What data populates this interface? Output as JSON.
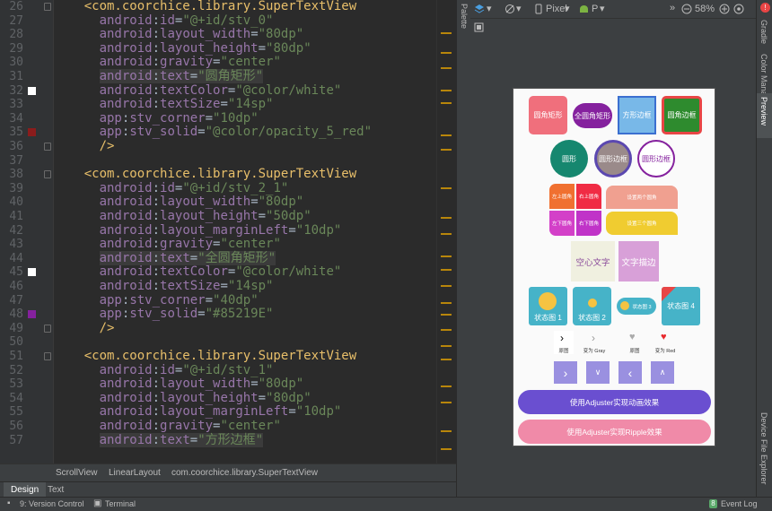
{
  "editor": {
    "lines": [
      {
        "n": "26",
        "parts": [
          [
            "sp",
            "    "
          ],
          [
            "tag",
            "<com.coorchice.library.SuperTextView"
          ]
        ]
      },
      {
        "n": "27",
        "parts": [
          [
            "sp",
            "      "
          ],
          [
            "attr",
            "android"
          ],
          [
            "eq",
            ":"
          ],
          [
            "attr",
            "id"
          ],
          [
            "eq",
            "="
          ],
          [
            "str",
            "\"@+id/stv_0\""
          ]
        ]
      },
      {
        "n": "28",
        "parts": [
          [
            "sp",
            "      "
          ],
          [
            "attr",
            "android"
          ],
          [
            "eq",
            ":"
          ],
          [
            "attr",
            "layout_width"
          ],
          [
            "eq",
            "="
          ],
          [
            "str",
            "\"80dp\""
          ]
        ]
      },
      {
        "n": "29",
        "parts": [
          [
            "sp",
            "      "
          ],
          [
            "attr",
            "android"
          ],
          [
            "eq",
            ":"
          ],
          [
            "attr",
            "layout_height"
          ],
          [
            "eq",
            "="
          ],
          [
            "str",
            "\"80dp\""
          ]
        ]
      },
      {
        "n": "30",
        "parts": [
          [
            "sp",
            "      "
          ],
          [
            "attr",
            "android"
          ],
          [
            "eq",
            ":"
          ],
          [
            "attr",
            "gravity"
          ],
          [
            "eq",
            "="
          ],
          [
            "str",
            "\"center\""
          ]
        ]
      },
      {
        "n": "31",
        "parts": [
          [
            "sp",
            "      "
          ],
          [
            "hattr",
            "android"
          ],
          [
            "heq",
            ":"
          ],
          [
            "hattr",
            "text"
          ],
          [
            "heq",
            "="
          ],
          [
            "hstr",
            "\"圆角矩形\""
          ]
        ]
      },
      {
        "n": "32",
        "parts": [
          [
            "sp",
            "      "
          ],
          [
            "attr",
            "android"
          ],
          [
            "eq",
            ":"
          ],
          [
            "attr",
            "textColor"
          ],
          [
            "eq",
            "="
          ],
          [
            "str",
            "\"@color/white\""
          ]
        ]
      },
      {
        "n": "33",
        "parts": [
          [
            "sp",
            "      "
          ],
          [
            "attr",
            "android"
          ],
          [
            "eq",
            ":"
          ],
          [
            "attr",
            "textSize"
          ],
          [
            "eq",
            "="
          ],
          [
            "str",
            "\"14sp\""
          ]
        ]
      },
      {
        "n": "34",
        "parts": [
          [
            "sp",
            "      "
          ],
          [
            "attr",
            "app"
          ],
          [
            "eq",
            ":"
          ],
          [
            "attr",
            "stv_corner"
          ],
          [
            "eq",
            "="
          ],
          [
            "str",
            "\"10dp\""
          ]
        ]
      },
      {
        "n": "35",
        "parts": [
          [
            "sp",
            "      "
          ],
          [
            "attr",
            "app"
          ],
          [
            "eq",
            ":"
          ],
          [
            "attr",
            "stv_solid"
          ],
          [
            "eq",
            "="
          ],
          [
            "str",
            "\"@color/opacity_5_red\""
          ]
        ]
      },
      {
        "n": "36",
        "parts": [
          [
            "sp",
            "      "
          ],
          [
            "tag",
            "/>"
          ]
        ]
      },
      {
        "n": "37",
        "parts": []
      },
      {
        "n": "38",
        "parts": [
          [
            "sp",
            "    "
          ],
          [
            "tag",
            "<com.coorchice.library.SuperTextView"
          ]
        ]
      },
      {
        "n": "39",
        "parts": [
          [
            "sp",
            "      "
          ],
          [
            "attr",
            "android"
          ],
          [
            "eq",
            ":"
          ],
          [
            "attr",
            "id"
          ],
          [
            "eq",
            "="
          ],
          [
            "str",
            "\"@+id/stv_2_1\""
          ]
        ]
      },
      {
        "n": "40",
        "parts": [
          [
            "sp",
            "      "
          ],
          [
            "attr",
            "android"
          ],
          [
            "eq",
            ":"
          ],
          [
            "attr",
            "layout_width"
          ],
          [
            "eq",
            "="
          ],
          [
            "str",
            "\"80dp\""
          ]
        ]
      },
      {
        "n": "41",
        "parts": [
          [
            "sp",
            "      "
          ],
          [
            "attr",
            "android"
          ],
          [
            "eq",
            ":"
          ],
          [
            "attr",
            "layout_height"
          ],
          [
            "eq",
            "="
          ],
          [
            "str",
            "\"50dp\""
          ]
        ]
      },
      {
        "n": "42",
        "parts": [
          [
            "sp",
            "      "
          ],
          [
            "attr",
            "android"
          ],
          [
            "eq",
            ":"
          ],
          [
            "attr",
            "layout_marginLeft"
          ],
          [
            "eq",
            "="
          ],
          [
            "str",
            "\"10dp\""
          ]
        ]
      },
      {
        "n": "43",
        "parts": [
          [
            "sp",
            "      "
          ],
          [
            "attr",
            "android"
          ],
          [
            "eq",
            ":"
          ],
          [
            "attr",
            "gravity"
          ],
          [
            "eq",
            "="
          ],
          [
            "str",
            "\"center\""
          ]
        ]
      },
      {
        "n": "44",
        "parts": [
          [
            "sp",
            "      "
          ],
          [
            "hattr",
            "android"
          ],
          [
            "heq",
            ":"
          ],
          [
            "hattr",
            "text"
          ],
          [
            "heq",
            "="
          ],
          [
            "hstr",
            "\"全圆角矩形\""
          ]
        ]
      },
      {
        "n": "45",
        "parts": [
          [
            "sp",
            "      "
          ],
          [
            "attr",
            "android"
          ],
          [
            "eq",
            ":"
          ],
          [
            "attr",
            "textColor"
          ],
          [
            "eq",
            "="
          ],
          [
            "str",
            "\"@color/white\""
          ]
        ]
      },
      {
        "n": "46",
        "parts": [
          [
            "sp",
            "      "
          ],
          [
            "attr",
            "android"
          ],
          [
            "eq",
            ":"
          ],
          [
            "attr",
            "textSize"
          ],
          [
            "eq",
            "="
          ],
          [
            "str",
            "\"14sp\""
          ]
        ]
      },
      {
        "n": "47",
        "parts": [
          [
            "sp",
            "      "
          ],
          [
            "attr",
            "app"
          ],
          [
            "eq",
            ":"
          ],
          [
            "attr",
            "stv_corner"
          ],
          [
            "eq",
            "="
          ],
          [
            "str",
            "\"40dp\""
          ]
        ]
      },
      {
        "n": "48",
        "parts": [
          [
            "sp",
            "      "
          ],
          [
            "attr",
            "app"
          ],
          [
            "eq",
            ":"
          ],
          [
            "attr",
            "stv_solid"
          ],
          [
            "eq",
            "="
          ],
          [
            "str",
            "\"#85219E\""
          ]
        ]
      },
      {
        "n": "49",
        "parts": [
          [
            "sp",
            "      "
          ],
          [
            "tag",
            "/>"
          ]
        ]
      },
      {
        "n": "50",
        "parts": []
      },
      {
        "n": "51",
        "parts": [
          [
            "sp",
            "    "
          ],
          [
            "tag",
            "<com.coorchice.library.SuperTextView"
          ]
        ]
      },
      {
        "n": "52",
        "parts": [
          [
            "sp",
            "      "
          ],
          [
            "attr",
            "android"
          ],
          [
            "eq",
            ":"
          ],
          [
            "attr",
            "id"
          ],
          [
            "eq",
            "="
          ],
          [
            "str",
            "\"@+id/stv_1\""
          ]
        ]
      },
      {
        "n": "53",
        "parts": [
          [
            "sp",
            "      "
          ],
          [
            "attr",
            "android"
          ],
          [
            "eq",
            ":"
          ],
          [
            "attr",
            "layout_width"
          ],
          [
            "eq",
            "="
          ],
          [
            "str",
            "\"80dp\""
          ]
        ]
      },
      {
        "n": "54",
        "parts": [
          [
            "sp",
            "      "
          ],
          [
            "attr",
            "android"
          ],
          [
            "eq",
            ":"
          ],
          [
            "attr",
            "layout_height"
          ],
          [
            "eq",
            "="
          ],
          [
            "str",
            "\"80dp\""
          ]
        ]
      },
      {
        "n": "55",
        "parts": [
          [
            "sp",
            "      "
          ],
          [
            "attr",
            "android"
          ],
          [
            "eq",
            ":"
          ],
          [
            "attr",
            "layout_marginLeft"
          ],
          [
            "eq",
            "="
          ],
          [
            "str",
            "\"10dp\""
          ]
        ]
      },
      {
        "n": "56",
        "parts": [
          [
            "sp",
            "      "
          ],
          [
            "attr",
            "android"
          ],
          [
            "eq",
            ":"
          ],
          [
            "attr",
            "gravity"
          ],
          [
            "eq",
            "="
          ],
          [
            "str",
            "\"center\""
          ]
        ]
      },
      {
        "n": "57",
        "parts": [
          [
            "sp",
            "      "
          ],
          [
            "hattr",
            "android"
          ],
          [
            "heq",
            ":"
          ],
          [
            "hattr",
            "text"
          ],
          [
            "heq",
            "="
          ],
          [
            "hstr",
            "\"方形边框\""
          ]
        ]
      }
    ],
    "gutter_swatches": [
      {
        "line": "32",
        "color": "#ffffff"
      },
      {
        "line": "35",
        "color": "#8b1c1c"
      },
      {
        "line": "45",
        "color": "#ffffff"
      },
      {
        "line": "48",
        "color": "#85219e"
      }
    ]
  },
  "breadcrumb": {
    "items": [
      "ScrollView",
      "LinearLayout",
      "com.coorchice.library.SuperTextView"
    ]
  },
  "editor_tabs": {
    "design": "Design",
    "text": "Text"
  },
  "side_panels": {
    "palette": "Palette",
    "gradle": "Gradle",
    "color_manager": "Color Manager",
    "preview": "Preview",
    "device_file_explorer": "Device File Explorer"
  },
  "preview_toolbar": {
    "device": "Pixel",
    "api": "P",
    "zoom": "58%"
  },
  "status_bar": {
    "version_control": "9: Version Control",
    "terminal": "Terminal",
    "event_log": "Event Log",
    "event_count": "8"
  },
  "phone": {
    "row1": [
      "圆角矩形",
      "全圆角矩形",
      "方形边框",
      "圆角边框"
    ],
    "row2": [
      "圆形",
      "圆形边框",
      "圆形边框"
    ],
    "row3_small": [
      "左上圆角",
      "右上圆角",
      "左下圆角",
      "右下圆角"
    ],
    "row3_wide": [
      "设置两个圆角",
      "设置三个圆角"
    ],
    "row4": [
      "空心文字",
      "文字描边"
    ],
    "row5": [
      "状态图 1",
      "状态图 2",
      "状态图 3",
      "状态图 4"
    ],
    "row6": [
      "原图",
      "变为 Gray",
      "原图",
      "变为 Red"
    ],
    "button1": "使用Adjuster实现动画效果",
    "button2": "使用Adjuster实现Ripple效果"
  },
  "colors": {
    "accent_purple": "#6a4fd0",
    "accent_pink": "#f08aa8",
    "red": "#e84545",
    "teal": "#46b3c8"
  }
}
